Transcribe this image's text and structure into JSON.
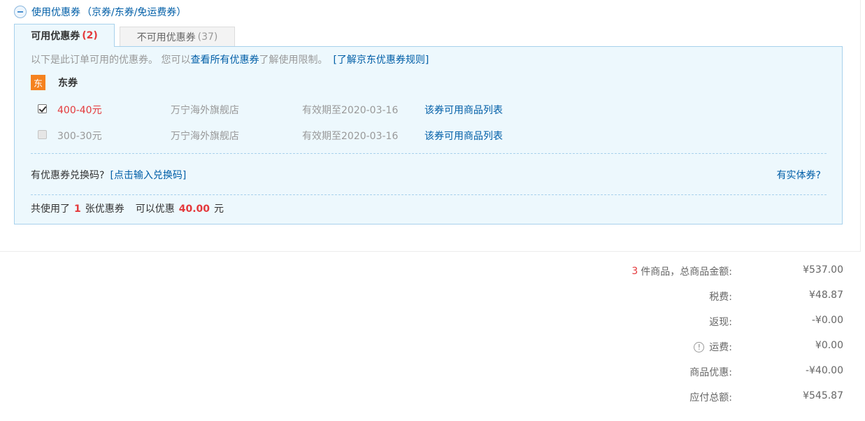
{
  "coupon_toggle": {
    "title": "使用优惠券",
    "subtitle": "（京券/东券/免运费券）"
  },
  "tabs": {
    "available_label": "可用优惠券",
    "available_count": "(2)",
    "unavailable_label": "不可用优惠券",
    "unavailable_count": "(37)"
  },
  "panel": {
    "intro_prefix": "以下是此订单可用的优惠券。 您可以",
    "view_all_link": "查看所有优惠券",
    "intro_suffix": "了解使用限制。",
    "rules_link": "[了解京东优惠券规则]",
    "group_badge": "东",
    "group_name": "东券",
    "coupons": [
      {
        "amount": "400-40元",
        "shop": "万宁海外旗舰店",
        "valid": "有效期至2020-03-16",
        "link": "该券可用商品列表",
        "checked": true
      },
      {
        "amount": "300-30元",
        "shop": "万宁海外旗舰店",
        "valid": "有效期至2020-03-16",
        "link": "该券可用商品列表",
        "checked": false
      }
    ],
    "redeem_prompt": "有优惠券兑换码?",
    "redeem_link": "[点击输入兑换码]",
    "physical_link": "有实体券?",
    "summary_prefix": "共使用了",
    "summary_count": "1",
    "summary_mid": "张优惠券",
    "summary_save": "可以优惠",
    "summary_amount": "40.00",
    "summary_unit": "元"
  },
  "totals": {
    "items_count": "3",
    "items_label": "件商品，总商品金额:",
    "items_value": "¥537.00",
    "tax_label": "税费:",
    "tax_value": "¥48.87",
    "cashback_label": "返现:",
    "cashback_value": "-¥0.00",
    "shipping_icon": "!",
    "shipping_label": "运费:",
    "shipping_value": "¥0.00",
    "discount_label": "商品优惠:",
    "discount_value": "-¥40.00",
    "payable_label": "应付总额:",
    "payable_value": "¥545.87"
  },
  "colors": {
    "link": "#005ea7",
    "accent_red": "#e4393c",
    "panel_bg": "#edf8fd",
    "panel_border": "#a8d1ec",
    "badge_orange": "#f5821f"
  }
}
